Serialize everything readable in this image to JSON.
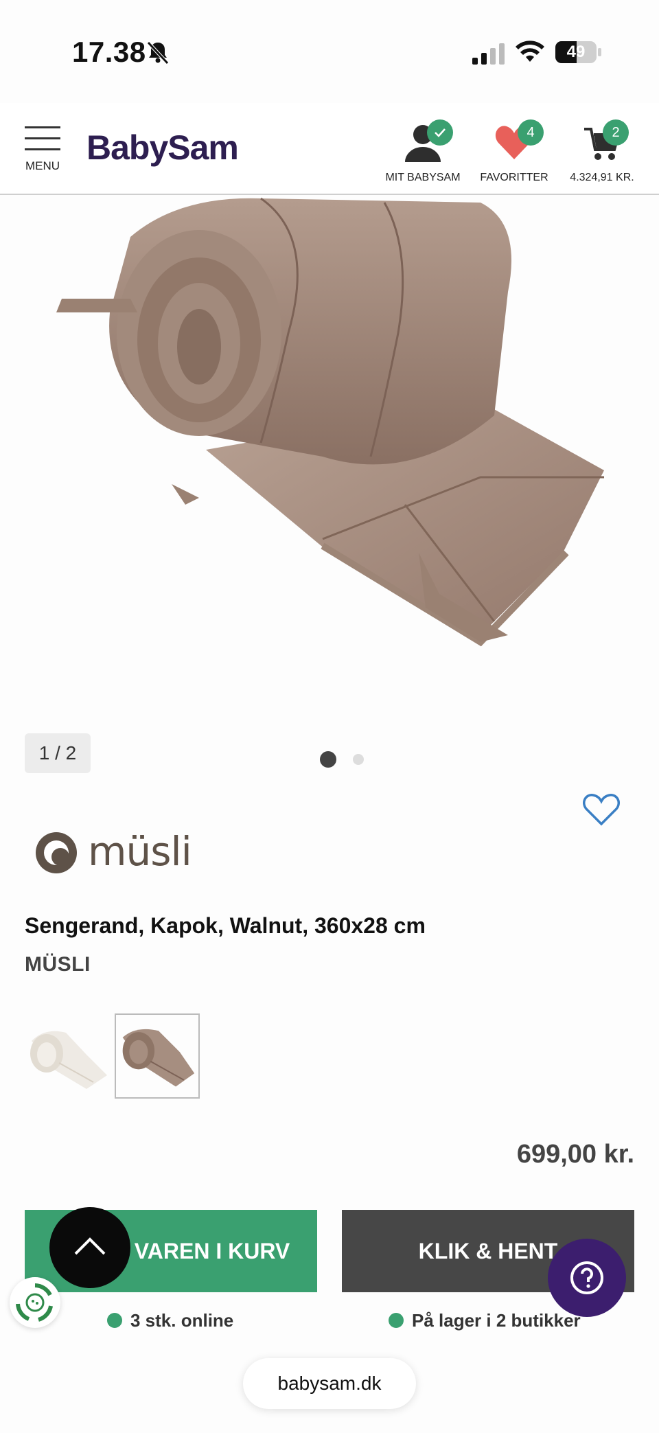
{
  "status_bar": {
    "time": "17.38",
    "battery": "49"
  },
  "header": {
    "menu_label": "MENU",
    "logo": "BabySam",
    "account": {
      "label": "MIT BABYSAM",
      "badge": "✓"
    },
    "favorites": {
      "label": "FAVORITTER",
      "badge": "4"
    },
    "cart": {
      "label": "4.324,91 KR.",
      "badge": "2"
    }
  },
  "gallery": {
    "counter": "1 / 2",
    "active_dot": 1,
    "total_dots": 2
  },
  "product": {
    "brand_logo_text": "müsli",
    "title": "Sengerand, Kapok, Walnut, 360x28 cm",
    "brand": "MÜSLI",
    "price": "699,00 kr.",
    "variants": [
      {
        "name": "natural-variant",
        "selected": false
      },
      {
        "name": "walnut-variant",
        "selected": true
      }
    ]
  },
  "actions": {
    "add_to_cart": "VAREN I KURV",
    "click_collect": "KLIK & HENT"
  },
  "availability": {
    "online": "3 stk. online",
    "stores": "På lager i 2 butikker"
  },
  "browser": {
    "url": "babysam.dk"
  },
  "colors": {
    "accent_green": "#3aa070",
    "brand_purple": "#2d1e50",
    "dark_button": "#474747",
    "heart_red": "#e8605a",
    "heart_outline": "#3a7fc4"
  }
}
